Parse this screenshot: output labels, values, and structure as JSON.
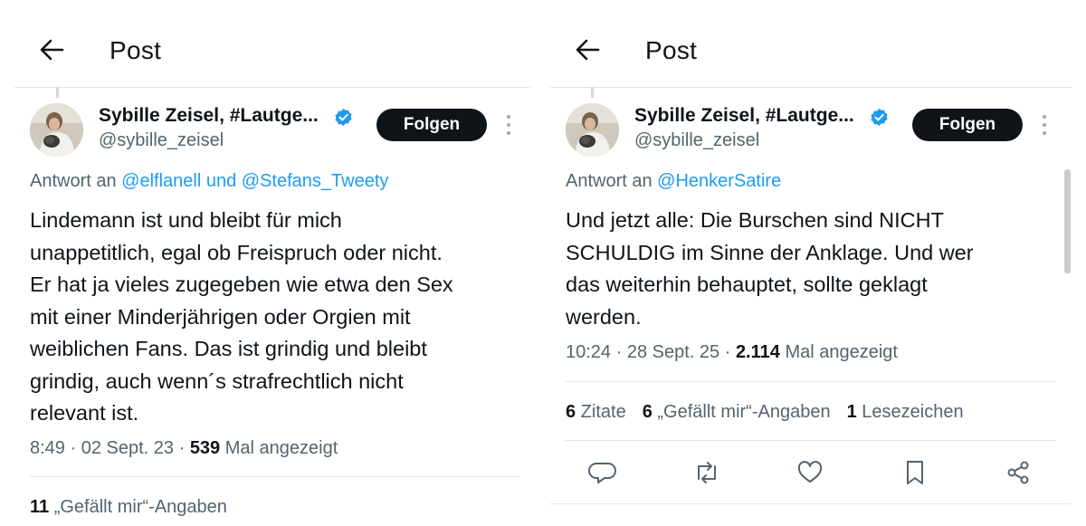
{
  "left": {
    "header_title": "Post",
    "author_name": "Sybille Zeisel, #Lautge...",
    "author_handle": "@sybille_zeisel",
    "follow_label": "Folgen",
    "reply_prefix": "Antwort an ",
    "reply_to_1": "@elflanell",
    "reply_joiner": " und ",
    "reply_to_2": "@Stefans_Tweety",
    "body_lines": [
      "Lindemann ist und bleibt für mich",
      "unappetitlich, egal ob Freispruch oder nicht.",
      "Er hat ja vieles zugegeben wie etwa den Sex",
      "mit einer Minderjährigen oder Orgien mit",
      "weiblichen Fans. Das ist grindig und bleibt",
      "grindig, auch wenn´s strafrechtlich nicht",
      "relevant ist."
    ],
    "time": "8:49",
    "date": "02 Sept. 23",
    "views_count": "539",
    "views_label": " Mal angezeigt",
    "likes_count": "11",
    "likes_label": " „Gefällt mir“-Angaben"
  },
  "right": {
    "header_title": "Post",
    "author_name": "Sybille Zeisel, #Lautge...",
    "author_handle": "@sybille_zeisel",
    "follow_label": "Folgen",
    "reply_prefix": "Antwort an ",
    "reply_to_1": "@HenkerSatire",
    "body_lines": [
      "Und jetzt alle: Die Burschen sind NICHT",
      "SCHULDIG im Sinne der Anklage. Und wer",
      "das weiterhin behauptet, sollte geklagt",
      "werden."
    ],
    "time": "10:24",
    "date": "28 Sept. 25",
    "views_count": "2.114",
    "views_label": " Mal angezeigt",
    "quotes_count": "6",
    "quotes_label": " Zitate",
    "likes_count": "6",
    "likes_label": " „Gefällt mir“-Angaben",
    "bookmarks_count": "1",
    "bookmarks_label": " Lesezeichen"
  },
  "icons": [
    "back-arrow-icon",
    "verified-badge-icon",
    "more-options-icon",
    "reply-icon",
    "repost-icon",
    "like-icon",
    "bookmark-icon",
    "share-icon"
  ],
  "colors": {
    "text": "#0f1419",
    "secondary": "#536471",
    "link": "#1d9bf0",
    "verified": "#1d9bf0",
    "follow_button_bg": "#0f1419",
    "divider": "#e3e6e9"
  }
}
